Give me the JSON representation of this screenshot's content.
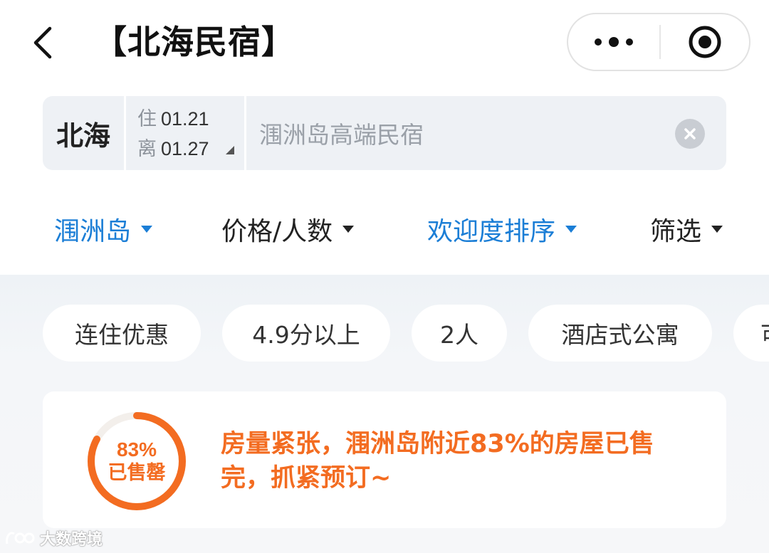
{
  "header": {
    "title": "【北海民宿】",
    "back_icon": "chevron-left-icon",
    "more_icon": "more-dots-icon",
    "close_icon": "target-close-icon"
  },
  "search": {
    "city": "北海",
    "checkin_label": "住",
    "checkin_date": "01.21",
    "checkout_label": "离",
    "checkout_date": "01.27",
    "query": "涠洲岛高端民宿",
    "clear_icon": "clear-circle-icon"
  },
  "filters": [
    {
      "label": "涠洲岛",
      "active": true
    },
    {
      "label": "价格/人数",
      "active": false
    },
    {
      "label": "欢迎度排序",
      "active": true
    },
    {
      "label": "筛选",
      "active": false
    }
  ],
  "chips": [
    "连住优惠",
    "4.9分以上",
    "2人",
    "酒店式公寓",
    "可"
  ],
  "notice": {
    "sold_percent": 83,
    "ring_value": "83%",
    "ring_label": "已售罄",
    "message": "房量紧张，涠洲岛附近83%的房屋已售完，抓紧预订~"
  },
  "watermark": {
    "text": "大数跨境"
  },
  "colors": {
    "accent_blue": "#1b7ed6",
    "alert_orange": "#f36c21",
    "search_bg": "#eef1f5"
  }
}
